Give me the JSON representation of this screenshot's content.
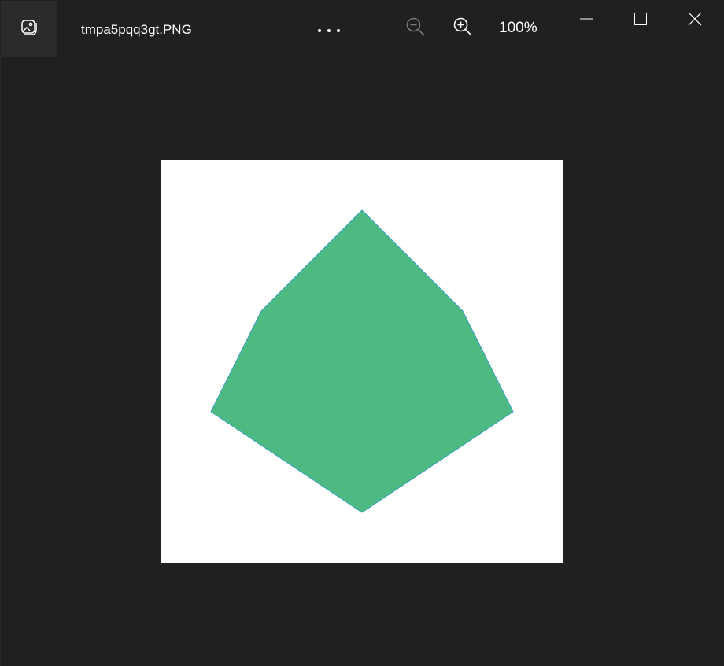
{
  "titlebar": {
    "app_icon": "photos-app-icon",
    "file_name": "tmpa5pqq3gt.PNG",
    "more_icon": "more-horizontal-icon",
    "zoom_out_icon": "zoom-out-icon",
    "zoom_in_icon": "zoom-in-icon",
    "zoom_level": "100%",
    "minimize_icon": "minimize-icon",
    "maximize_icon": "maximize-icon",
    "close_icon": "close-icon"
  },
  "image": {
    "background": "#ffffff",
    "polygon_fill": "#4dba82",
    "polygon_stroke": "#3a9fc4"
  },
  "colors": {
    "window_bg": "#202020",
    "app_button_bg": "#2b2b2b",
    "text": "#ffffff",
    "disabled_icon": "#7a7a7a"
  }
}
